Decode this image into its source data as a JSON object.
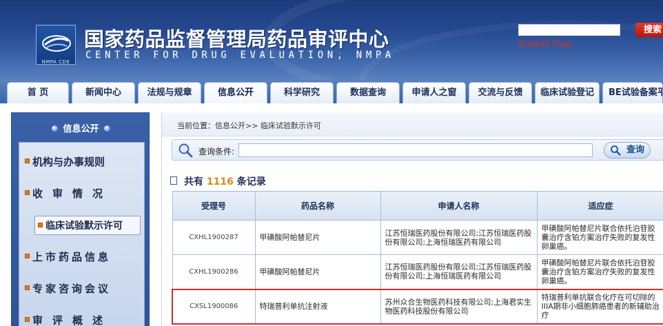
{
  "header": {
    "title": "国家药品监督管理局药品审评中心",
    "subtitle": "CENTER FOR DRUG EVALUATION, NMPA",
    "logo_caption": "NMPA CDE",
    "search_button": "搜索",
    "english_link": "English Page"
  },
  "nav": {
    "tabs": [
      {
        "label": "首  页"
      },
      {
        "label": "新闻中心"
      },
      {
        "label": "法规与规章"
      },
      {
        "label": "信息公开",
        "active": true
      },
      {
        "label": "科学研究"
      },
      {
        "label": "数据查询"
      },
      {
        "label": "申请人之窗"
      },
      {
        "label": "交流与反馈"
      },
      {
        "label": "临床试验登记"
      },
      {
        "label": "BE试验备案平"
      }
    ]
  },
  "sidebar": {
    "title": "信息公开",
    "items": [
      {
        "label": "机构与办事规则"
      },
      {
        "label": "收审情况"
      },
      {
        "label": "临床试验默示许可",
        "active": true
      },
      {
        "label": "上市药品信息"
      },
      {
        "label": "专家咨询会议"
      },
      {
        "label": "审评概述"
      }
    ]
  },
  "main": {
    "breadcrumb": "当前位置：信息公开>> 临床试验默示许可",
    "query_label": "查询条件:",
    "query_value": "",
    "query_button": "查询",
    "count_prefix": "共有",
    "count_value": "1116",
    "count_suffix": "条记录",
    "table": {
      "headers": [
        "受理号",
        "药品名称",
        "申请人名称",
        "适应症"
      ],
      "rows": [
        {
          "code": "CXHL1900287",
          "drug": "甲磺酸阿帕替尼片",
          "applicant": "江苏恒瑞医药股份有限公司;江苏恒瑞医药股份有限公司;上海恒瑞医药有限公司",
          "indication": "甲磺酸阿帕替尼片联合依托泊苷胶囊治疗含铂方案治疗失败的复发性卵巢癌。"
        },
        {
          "code": "CXHL1900286",
          "drug": "甲磺酸阿帕替尼片",
          "applicant": "江苏恒瑞医药股份有限公司;江苏恒瑞医药股份有限公司;上海恒瑞医药有限公司",
          "indication": "甲磺酸阿帕替尼片联合依托泊苷胶囊治疗含铂方案治疗失败的复发性卵巢癌。"
        },
        {
          "code": "CXSL1900086",
          "drug": "特瑞普利单抗注射液",
          "applicant": "苏州众合生物医药科技有限公司;上海君实生物医药科技股份有限公司",
          "indication": "特瑞普利单抗联合化疗在可切除的IIIA期非小细胞肺癌患者的新辅助治疗",
          "highlight": true
        }
      ]
    }
  }
}
